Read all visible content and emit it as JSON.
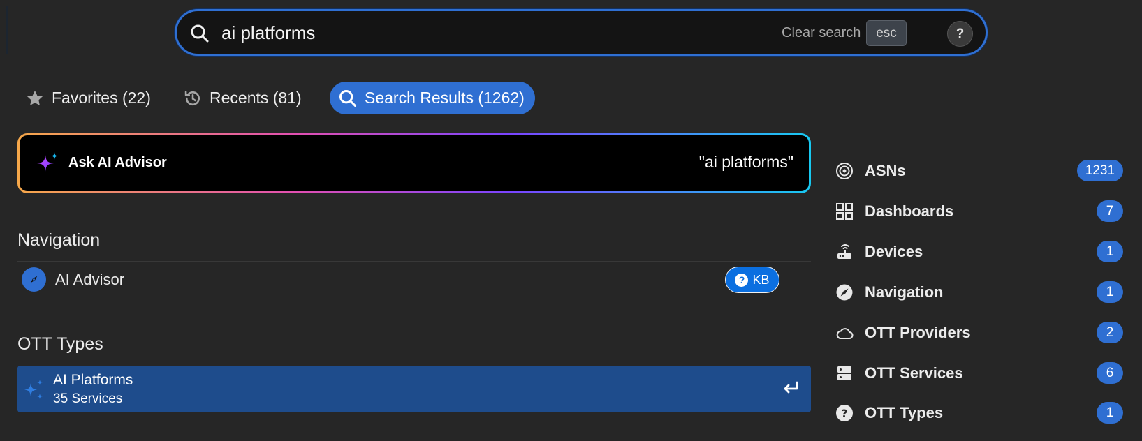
{
  "search": {
    "value": "ai platforms",
    "clear_label": "Clear search",
    "esc_key": "esc",
    "help": "?"
  },
  "tabs": [
    {
      "label": "Favorites (22)",
      "icon": "star-icon"
    },
    {
      "label": "Recents (81)",
      "icon": "history-icon"
    },
    {
      "label": "Search Results (1262)",
      "icon": "search-icon",
      "active": true
    }
  ],
  "ai_advisor": {
    "label": "Ask AI Advisor",
    "query": "\"ai platforms\""
  },
  "sections": {
    "navigation": {
      "title": "Navigation",
      "items": [
        {
          "label": "AI Advisor",
          "badge": "KB"
        }
      ]
    },
    "ott_types": {
      "title": "OTT Types",
      "items": [
        {
          "title": "AI Platforms",
          "subtitle": "35 Services"
        }
      ]
    }
  },
  "facets": [
    {
      "label": "ASNs",
      "count": "1231",
      "icon": "target-icon"
    },
    {
      "label": "Dashboards",
      "count": "7",
      "icon": "grid-icon"
    },
    {
      "label": "Devices",
      "count": "1",
      "icon": "router-icon"
    },
    {
      "label": "Navigation",
      "count": "1",
      "icon": "compass-icon"
    },
    {
      "label": "OTT Providers",
      "count": "2",
      "icon": "cloud-icon"
    },
    {
      "label": "OTT Services",
      "count": "6",
      "icon": "server-icon"
    },
    {
      "label": "OTT Types",
      "count": "1",
      "icon": "question-icon"
    }
  ],
  "colors": {
    "accent": "#2f6fd2",
    "selected_row": "#1e4c8c",
    "background": "#262626"
  }
}
